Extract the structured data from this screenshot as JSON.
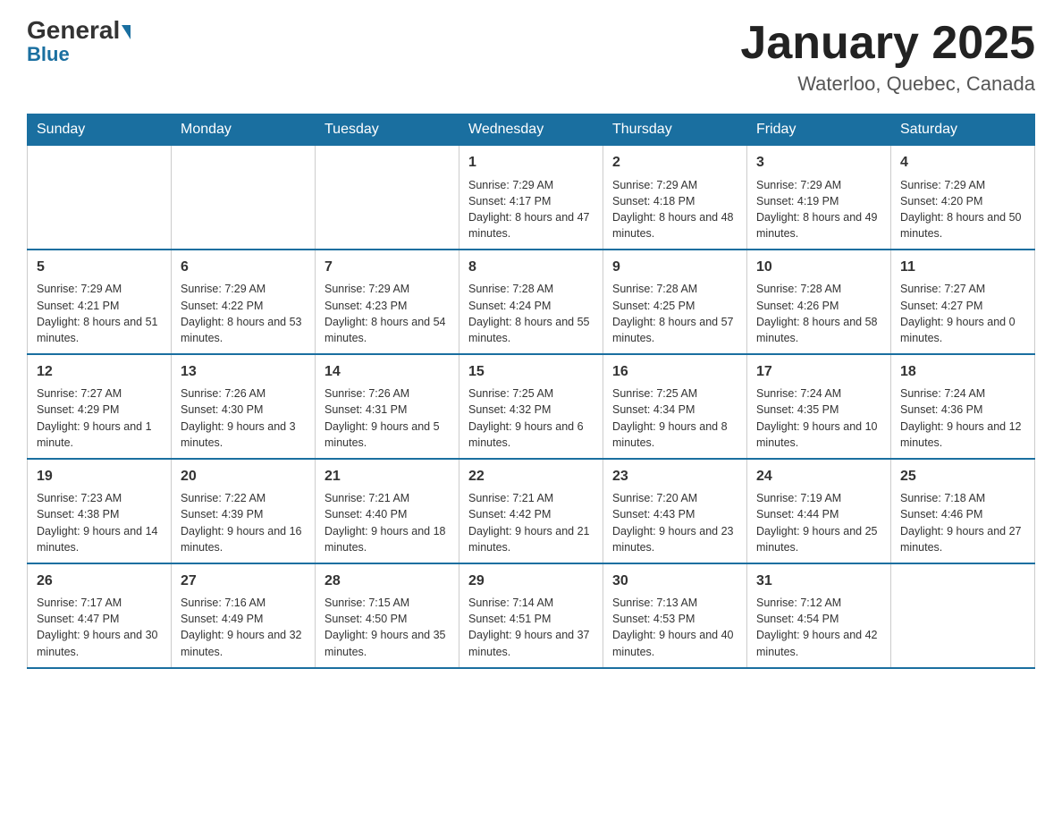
{
  "logo": {
    "general": "General",
    "blue": "Blue"
  },
  "title": "January 2025",
  "subtitle": "Waterloo, Quebec, Canada",
  "weekdays": [
    "Sunday",
    "Monday",
    "Tuesday",
    "Wednesday",
    "Thursday",
    "Friday",
    "Saturday"
  ],
  "weeks": [
    [
      {
        "day": "",
        "info": ""
      },
      {
        "day": "",
        "info": ""
      },
      {
        "day": "",
        "info": ""
      },
      {
        "day": "1",
        "info": "Sunrise: 7:29 AM\nSunset: 4:17 PM\nDaylight: 8 hours\nand 47 minutes."
      },
      {
        "day": "2",
        "info": "Sunrise: 7:29 AM\nSunset: 4:18 PM\nDaylight: 8 hours\nand 48 minutes."
      },
      {
        "day": "3",
        "info": "Sunrise: 7:29 AM\nSunset: 4:19 PM\nDaylight: 8 hours\nand 49 minutes."
      },
      {
        "day": "4",
        "info": "Sunrise: 7:29 AM\nSunset: 4:20 PM\nDaylight: 8 hours\nand 50 minutes."
      }
    ],
    [
      {
        "day": "5",
        "info": "Sunrise: 7:29 AM\nSunset: 4:21 PM\nDaylight: 8 hours\nand 51 minutes."
      },
      {
        "day": "6",
        "info": "Sunrise: 7:29 AM\nSunset: 4:22 PM\nDaylight: 8 hours\nand 53 minutes."
      },
      {
        "day": "7",
        "info": "Sunrise: 7:29 AM\nSunset: 4:23 PM\nDaylight: 8 hours\nand 54 minutes."
      },
      {
        "day": "8",
        "info": "Sunrise: 7:28 AM\nSunset: 4:24 PM\nDaylight: 8 hours\nand 55 minutes."
      },
      {
        "day": "9",
        "info": "Sunrise: 7:28 AM\nSunset: 4:25 PM\nDaylight: 8 hours\nand 57 minutes."
      },
      {
        "day": "10",
        "info": "Sunrise: 7:28 AM\nSunset: 4:26 PM\nDaylight: 8 hours\nand 58 minutes."
      },
      {
        "day": "11",
        "info": "Sunrise: 7:27 AM\nSunset: 4:27 PM\nDaylight: 9 hours\nand 0 minutes."
      }
    ],
    [
      {
        "day": "12",
        "info": "Sunrise: 7:27 AM\nSunset: 4:29 PM\nDaylight: 9 hours\nand 1 minute."
      },
      {
        "day": "13",
        "info": "Sunrise: 7:26 AM\nSunset: 4:30 PM\nDaylight: 9 hours\nand 3 minutes."
      },
      {
        "day": "14",
        "info": "Sunrise: 7:26 AM\nSunset: 4:31 PM\nDaylight: 9 hours\nand 5 minutes."
      },
      {
        "day": "15",
        "info": "Sunrise: 7:25 AM\nSunset: 4:32 PM\nDaylight: 9 hours\nand 6 minutes."
      },
      {
        "day": "16",
        "info": "Sunrise: 7:25 AM\nSunset: 4:34 PM\nDaylight: 9 hours\nand 8 minutes."
      },
      {
        "day": "17",
        "info": "Sunrise: 7:24 AM\nSunset: 4:35 PM\nDaylight: 9 hours\nand 10 minutes."
      },
      {
        "day": "18",
        "info": "Sunrise: 7:24 AM\nSunset: 4:36 PM\nDaylight: 9 hours\nand 12 minutes."
      }
    ],
    [
      {
        "day": "19",
        "info": "Sunrise: 7:23 AM\nSunset: 4:38 PM\nDaylight: 9 hours\nand 14 minutes."
      },
      {
        "day": "20",
        "info": "Sunrise: 7:22 AM\nSunset: 4:39 PM\nDaylight: 9 hours\nand 16 minutes."
      },
      {
        "day": "21",
        "info": "Sunrise: 7:21 AM\nSunset: 4:40 PM\nDaylight: 9 hours\nand 18 minutes."
      },
      {
        "day": "22",
        "info": "Sunrise: 7:21 AM\nSunset: 4:42 PM\nDaylight: 9 hours\nand 21 minutes."
      },
      {
        "day": "23",
        "info": "Sunrise: 7:20 AM\nSunset: 4:43 PM\nDaylight: 9 hours\nand 23 minutes."
      },
      {
        "day": "24",
        "info": "Sunrise: 7:19 AM\nSunset: 4:44 PM\nDaylight: 9 hours\nand 25 minutes."
      },
      {
        "day": "25",
        "info": "Sunrise: 7:18 AM\nSunset: 4:46 PM\nDaylight: 9 hours\nand 27 minutes."
      }
    ],
    [
      {
        "day": "26",
        "info": "Sunrise: 7:17 AM\nSunset: 4:47 PM\nDaylight: 9 hours\nand 30 minutes."
      },
      {
        "day": "27",
        "info": "Sunrise: 7:16 AM\nSunset: 4:49 PM\nDaylight: 9 hours\nand 32 minutes."
      },
      {
        "day": "28",
        "info": "Sunrise: 7:15 AM\nSunset: 4:50 PM\nDaylight: 9 hours\nand 35 minutes."
      },
      {
        "day": "29",
        "info": "Sunrise: 7:14 AM\nSunset: 4:51 PM\nDaylight: 9 hours\nand 37 minutes."
      },
      {
        "day": "30",
        "info": "Sunrise: 7:13 AM\nSunset: 4:53 PM\nDaylight: 9 hours\nand 40 minutes."
      },
      {
        "day": "31",
        "info": "Sunrise: 7:12 AM\nSunset: 4:54 PM\nDaylight: 9 hours\nand 42 minutes."
      },
      {
        "day": "",
        "info": ""
      }
    ]
  ]
}
